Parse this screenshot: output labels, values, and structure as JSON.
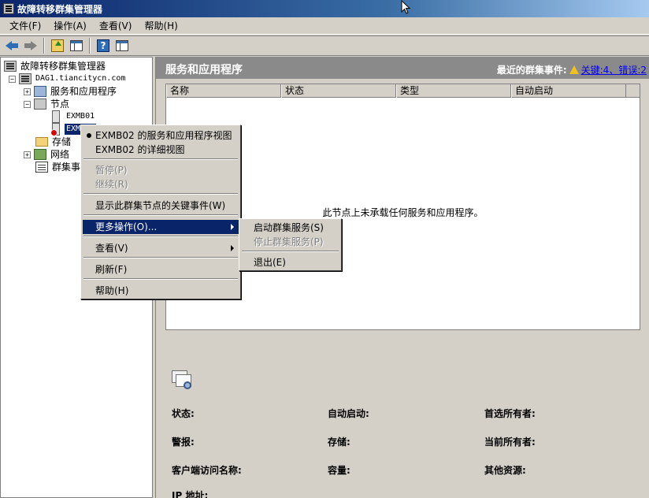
{
  "window": {
    "title": "故障转移群集管理器"
  },
  "menubar": {
    "items": [
      "文件(F)",
      "操作(A)",
      "查看(V)",
      "帮助(H)"
    ]
  },
  "tree": {
    "root": "故障转移群集管理器",
    "cluster": "DAG1.tiancitycn.com",
    "services": "服务和应用程序",
    "nodes": "节点",
    "node1": "EXMB01",
    "node2": "EXMB02",
    "storage": "存储",
    "network": "网络",
    "events": "群集事件"
  },
  "main": {
    "title": "服务和应用程序",
    "recent_events_label": "最近的群集事件:",
    "critical_link": "关键:4、错误:2",
    "columns": [
      "名称",
      "状态",
      "类型",
      "自动启动"
    ],
    "empty_message": "此节点上未承载任何服务和应用程序。",
    "details": {
      "status": "状态:",
      "auto_start": "自动启动:",
      "preferred_owner": "首选所有者:",
      "alerts": "警报:",
      "storage": "存储:",
      "current_owner": "当前所有者:",
      "client_access_name": "客户端访问名称:",
      "capacity": "容量:",
      "other_resources": "其他资源:",
      "ip_address": "IP 地址:"
    }
  },
  "context_menu": {
    "services_view": "EXMB02 的服务和应用程序视图",
    "detail_view": "EXMB02 的详细视图",
    "pause": "暂停(P)",
    "resume": "继续(R)",
    "show_critical": "显示此群集节点的关键事件(W)",
    "more_actions": "更多操作(O)...",
    "view": "查看(V)",
    "refresh": "刷新(F)",
    "help": "帮助(H)"
  },
  "submenu": {
    "start_service": "启动群集服务(S)",
    "stop_service": "停止群集服务(P)",
    "exit": "退出(E)"
  },
  "colors": {
    "selection": "#0a246a",
    "face": "#d4d0c8",
    "header_band": "#8a8a8a",
    "link": "#0000ee"
  }
}
